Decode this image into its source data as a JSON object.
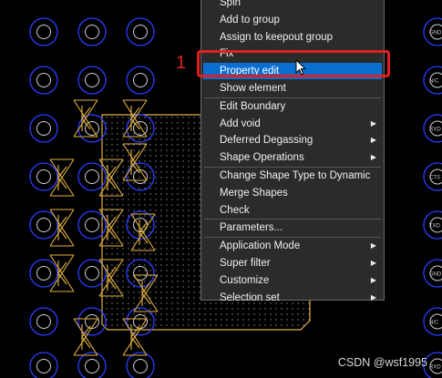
{
  "annotation": {
    "step_number": "1"
  },
  "watermark": "CSDN @wsf1995",
  "canvas": {
    "board_color": "#000000",
    "pad_ring_color": "#2a3cff",
    "outline_color": "#e0b040",
    "pad_text": [
      "GND",
      "N/C",
      "RXD",
      "CTS",
      "TXD"
    ]
  },
  "context_menu": {
    "items": [
      {
        "label": "Spin",
        "submenu": false,
        "selected": false
      },
      {
        "label": "Add to group",
        "submenu": false,
        "selected": false
      },
      {
        "label": "Assign to keepout group",
        "submenu": false,
        "selected": false
      },
      {
        "label": "Fix",
        "submenu": false,
        "selected": false
      },
      {
        "label": "Property edit",
        "submenu": false,
        "selected": true
      },
      {
        "label": "Show element",
        "submenu": false,
        "selected": false
      },
      {
        "label": "Edit Boundary",
        "submenu": false,
        "selected": false
      },
      {
        "label": "Add void",
        "submenu": true,
        "selected": false
      },
      {
        "label": "Deferred Degassing",
        "submenu": true,
        "selected": false
      },
      {
        "label": "Shape Operations",
        "submenu": true,
        "selected": false
      },
      {
        "label": "Change Shape Type to Dynamic",
        "submenu": false,
        "selected": false
      },
      {
        "label": "Merge Shapes",
        "submenu": false,
        "selected": false
      },
      {
        "label": "Check",
        "submenu": false,
        "selected": false
      },
      {
        "label": "Parameters...",
        "submenu": false,
        "selected": false
      },
      {
        "label": "Application Mode",
        "submenu": true,
        "selected": false
      },
      {
        "label": "Super filter",
        "submenu": true,
        "selected": false
      },
      {
        "label": "Customize",
        "submenu": true,
        "selected": false
      },
      {
        "label": "Selection set",
        "submenu": true,
        "selected": false
      }
    ],
    "submenu_arrow": "▶"
  }
}
